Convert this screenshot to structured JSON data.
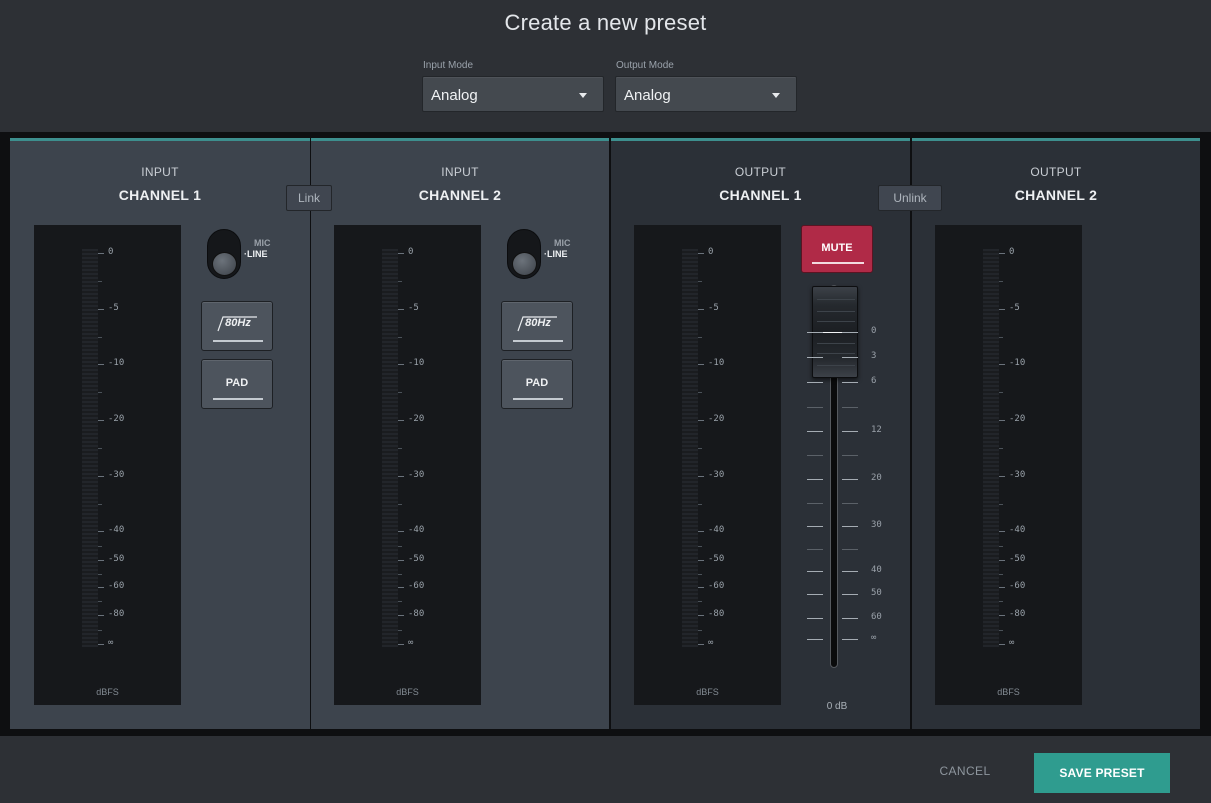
{
  "dialog": {
    "title": "Create a new preset"
  },
  "modes": {
    "input": {
      "label": "Input Mode",
      "value": "Analog"
    },
    "output": {
      "label": "Output Mode",
      "value": "Analog"
    }
  },
  "meter_scale": [
    "0",
    "-5",
    "-10",
    "-20",
    "-30",
    "-40",
    "-50",
    "-60",
    "-80",
    "∞"
  ],
  "meter_unit": "dBFS",
  "channels": [
    {
      "kind": "INPUT",
      "name": "CHANNEL 1"
    },
    {
      "kind": "INPUT",
      "name": "CHANNEL 2"
    },
    {
      "kind": "OUTPUT",
      "name": "CHANNEL 1"
    },
    {
      "kind": "OUTPUT",
      "name": "CHANNEL 2"
    }
  ],
  "input_link": {
    "label": "Link"
  },
  "output_link": {
    "label": "Unlink"
  },
  "input_controls": {
    "switch_mic": "MIC",
    "switch_line": "·LINE",
    "selected_source": "LINE",
    "hpf_label": "80Hz",
    "pad_label": "PAD"
  },
  "output_controls": {
    "mute_label": "MUTE",
    "fader_scale": [
      "0",
      "3",
      "6",
      "12",
      "20",
      "30",
      "40",
      "50",
      "60",
      "∞"
    ],
    "fader_value_db": 0,
    "fader_value_label": "0 dB"
  },
  "footer": {
    "cancel_label": "CANCEL",
    "save_label": "SAVE PRESET"
  },
  "colors": {
    "accent": "#2f9c8f",
    "mute": "#b02a47",
    "panel_top_border": "#3d8f8e"
  }
}
